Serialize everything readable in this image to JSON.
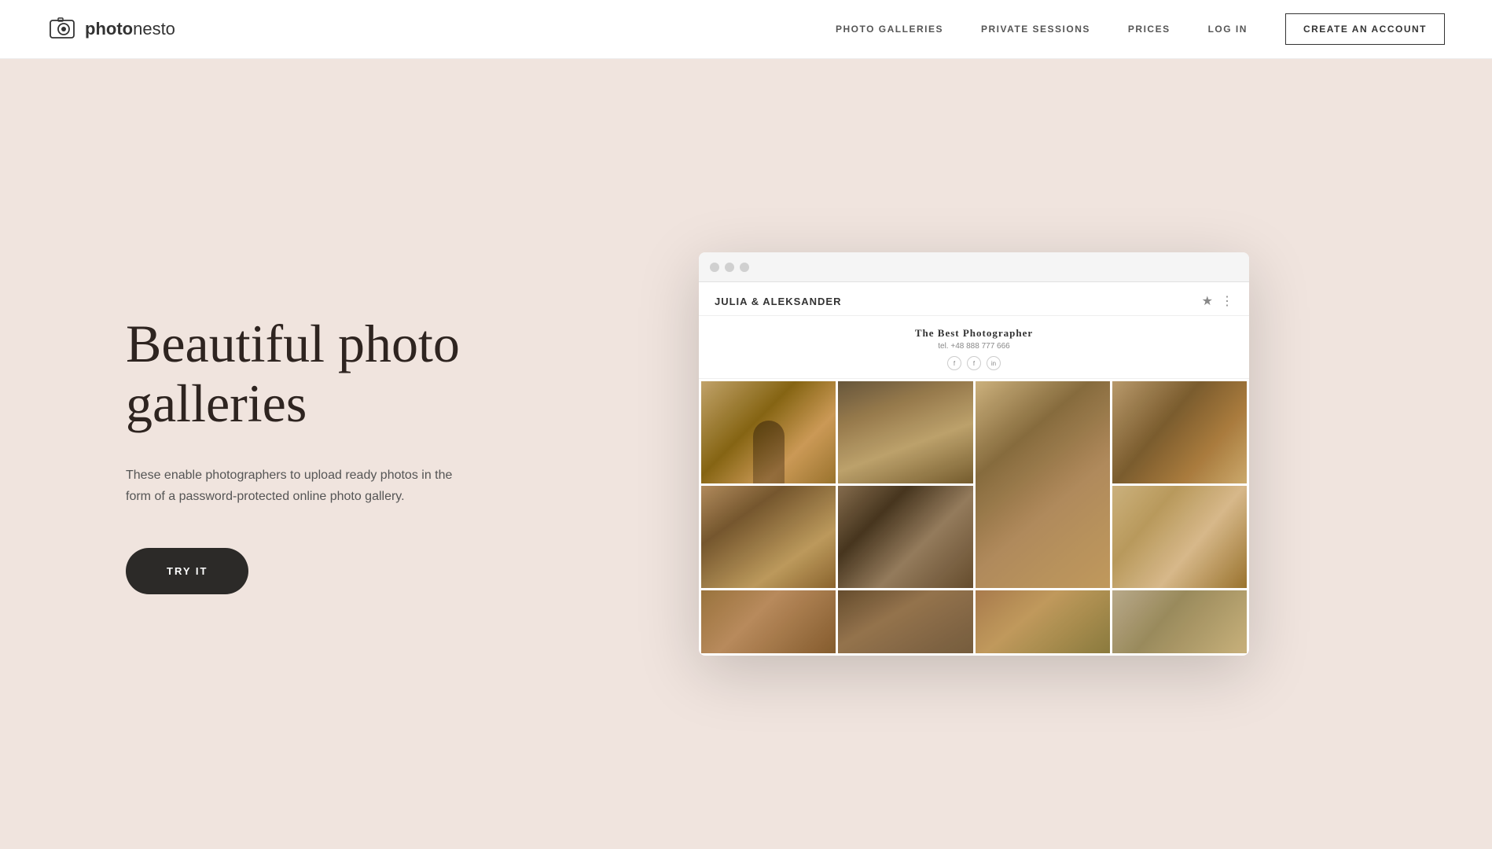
{
  "nav": {
    "logo_bold": "photo",
    "logo_light": "nesto",
    "links": [
      {
        "id": "photo-galleries",
        "label": "PHOTO GALLERIES"
      },
      {
        "id": "private-sessions",
        "label": "PRIVATE SESSIONS"
      },
      {
        "id": "prices",
        "label": "PRICES"
      },
      {
        "id": "log-in",
        "label": "LOG IN"
      }
    ],
    "cta_label": "CREATE AN ACCOUNT"
  },
  "hero": {
    "title": "Beautiful photo galleries",
    "description": "These enable photographers to upload ready photos in the form of a password-protected online photo gallery.",
    "try_button": "TRY IT"
  },
  "mockup": {
    "gallery_name": "JULIA & ALEKSANDER",
    "photographer_name": "The Best Photographer",
    "photographer_tel": "tel. +48 888 777 666",
    "social": [
      "f",
      "f",
      "in"
    ]
  },
  "colors": {
    "background": "#f0e4de",
    "nav_bg": "#ffffff",
    "button_dark": "#2c2a28",
    "text_dark": "#2e2420",
    "text_muted": "#555555"
  }
}
